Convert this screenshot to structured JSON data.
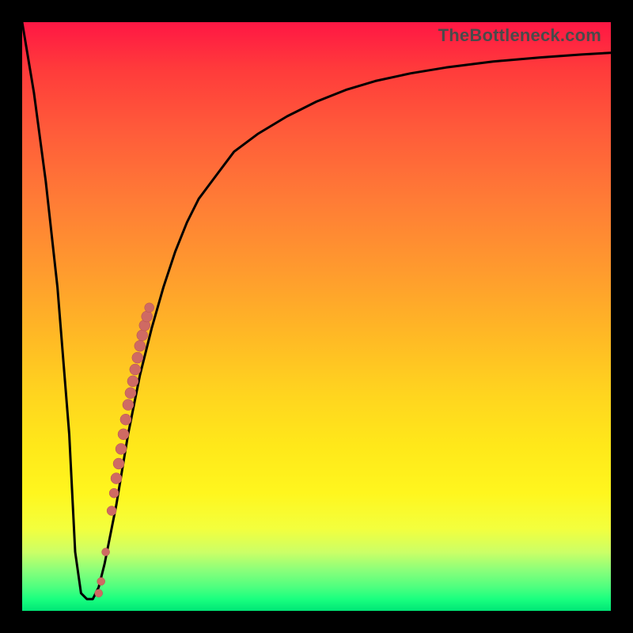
{
  "watermark": "TheBottleneck.com",
  "colors": {
    "curve": "#000000",
    "marker_fill": "#cf6a63",
    "marker_stroke": "#b55550",
    "background_frame": "#000000"
  },
  "chart_data": {
    "type": "line",
    "title": "",
    "xlabel": "",
    "ylabel": "",
    "xlim": [
      0,
      100
    ],
    "ylim": [
      0,
      100
    ],
    "series": [
      {
        "name": "bottleneck-curve",
        "x": [
          0,
          2,
          4,
          6,
          8,
          9,
          10,
          11,
          12,
          13,
          14,
          16,
          18,
          20,
          22,
          24,
          26,
          28,
          30,
          33,
          36,
          40,
          45,
          50,
          55,
          60,
          66,
          72,
          80,
          88,
          95,
          100
        ],
        "y": [
          100,
          88,
          73,
          55,
          30,
          10,
          3,
          2,
          2,
          4,
          8,
          18,
          30,
          40,
          48,
          55,
          61,
          66,
          70,
          74,
          78,
          81,
          84,
          86.5,
          88.5,
          90,
          91.3,
          92.3,
          93.3,
          94,
          94.5,
          94.8
        ]
      }
    ],
    "markers": {
      "name": "highlight-points",
      "x": [
        13.0,
        13.4,
        14.2,
        15.2,
        15.6,
        16.0,
        16.4,
        16.8,
        17.2,
        17.6,
        18.0,
        18.4,
        18.8,
        19.2,
        19.6,
        20.0,
        20.4,
        20.8,
        21.2,
        21.6
      ],
      "y": [
        3.0,
        5.0,
        10.0,
        17.0,
        20.0,
        22.5,
        25.0,
        27.5,
        30.0,
        32.5,
        35.0,
        37.0,
        39.0,
        41.0,
        43.0,
        45.0,
        46.8,
        48.5,
        50.0,
        51.5
      ],
      "radius": [
        5,
        5,
        5,
        6,
        6,
        7,
        7,
        7,
        7,
        7,
        7,
        7,
        7,
        7,
        7,
        7,
        7,
        7,
        7,
        6
      ]
    }
  }
}
